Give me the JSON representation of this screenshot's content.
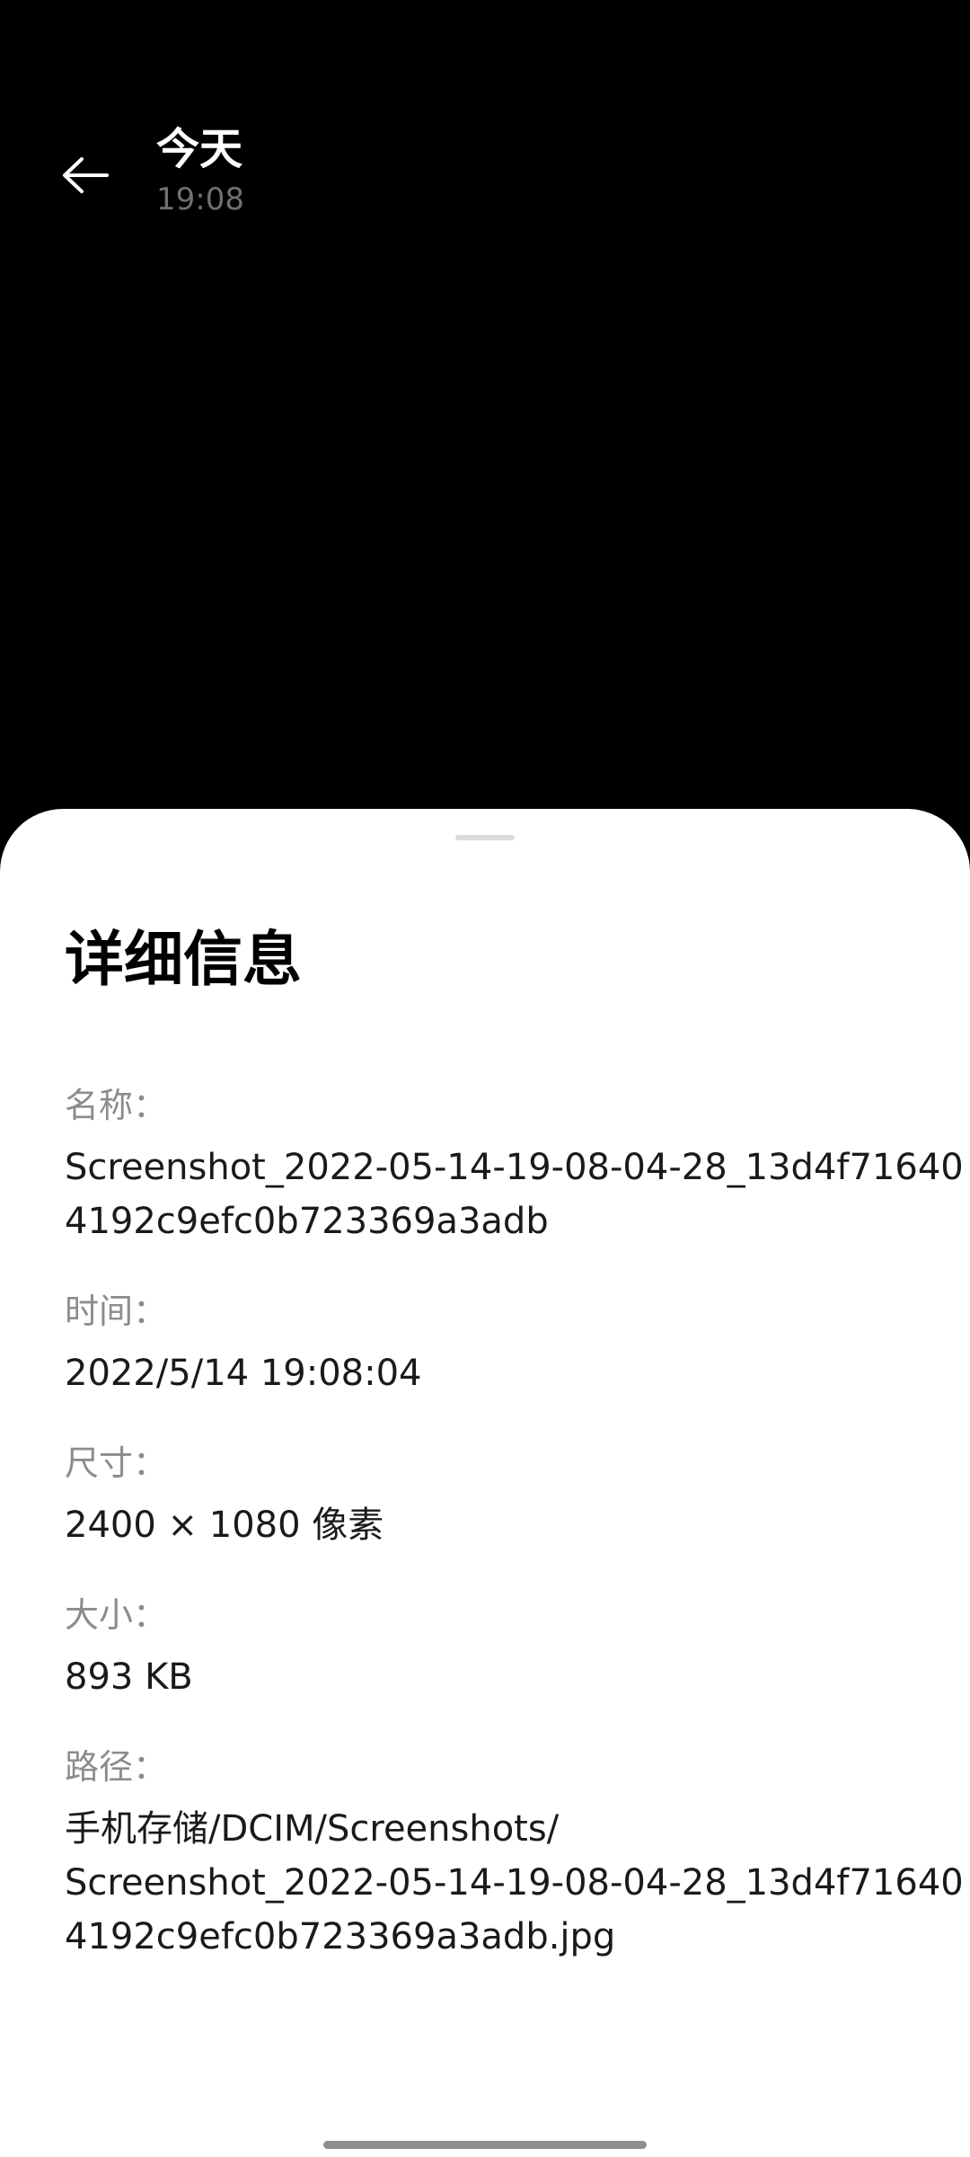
{
  "header": {
    "title": "今天",
    "subtitle": "19:08",
    "back_icon": "arrow-left-icon"
  },
  "sheet": {
    "title": "详细信息",
    "items": [
      {
        "label": "名称：",
        "value_lines": [
          "Screenshot_2022-05-14-19-08-04-28_13d4f71640",
          "4192c9efc0b723369a3adb"
        ]
      },
      {
        "label": "时间：",
        "value_lines": [
          "2022/5/14 19:08:04"
        ]
      },
      {
        "label": "尺寸：",
        "value_lines": [
          "2400 × 1080 像素"
        ]
      },
      {
        "label": "大小：",
        "value_lines": [
          "893 KB"
        ]
      },
      {
        "label": "路径：",
        "value_lines": [
          "手机存储/DCIM/Screenshots/",
          "Screenshot_2022-05-14-19-08-04-28_13d4f71640",
          "4192c9efc0b723369a3adb.jpg"
        ]
      }
    ]
  },
  "colors": {
    "viewer_background": "#000000",
    "sheet_background": "#ffffff",
    "label_color": "#8c8c8c",
    "value_color": "#1a1a1a",
    "subtitle_color": "#6f6f6f"
  }
}
